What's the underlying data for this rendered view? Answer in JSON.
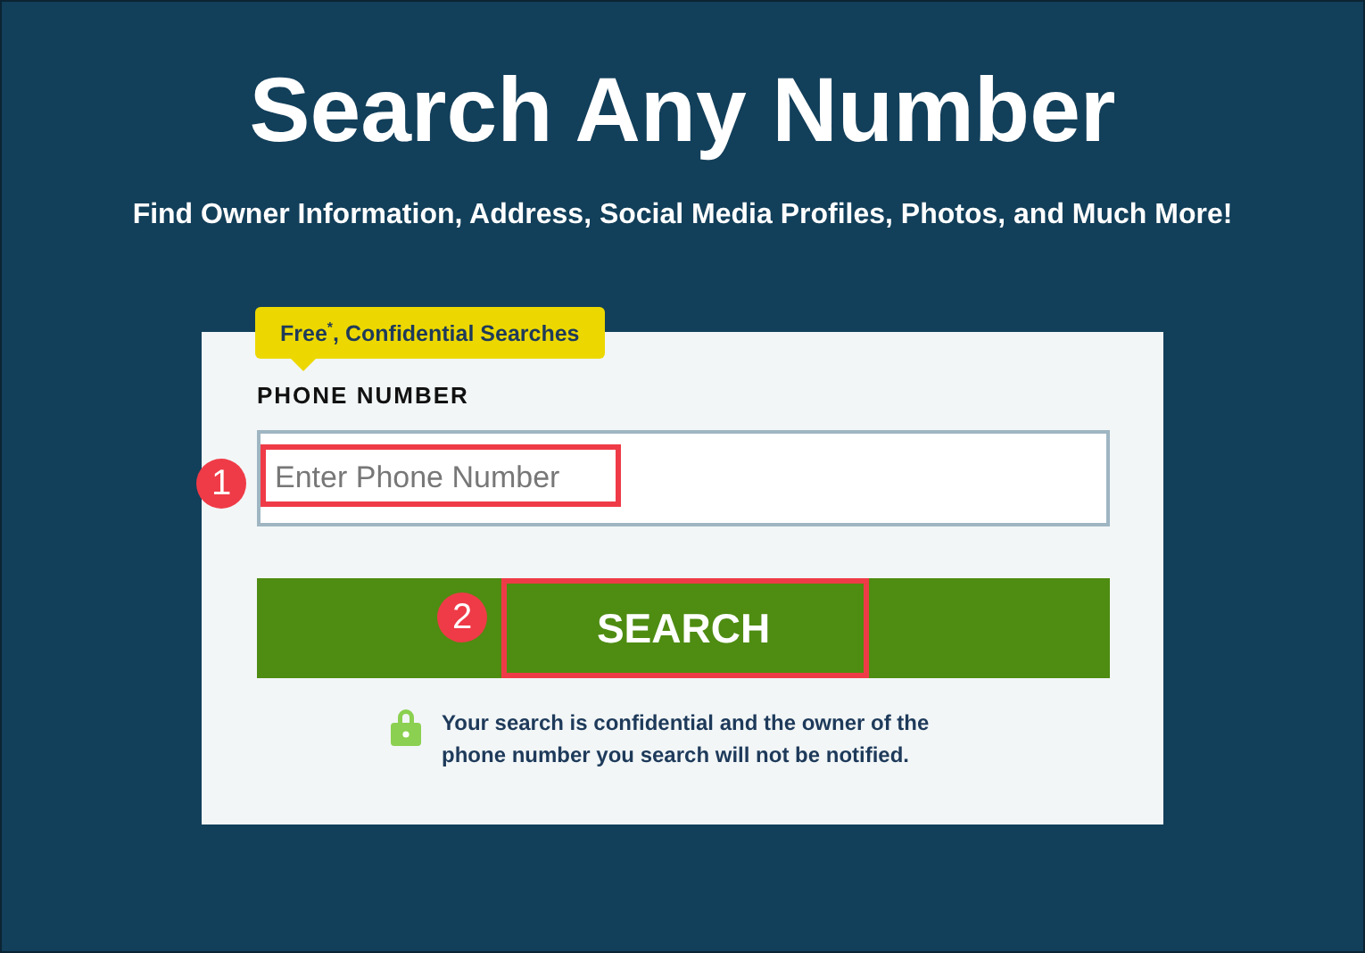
{
  "hero": {
    "title": "Search Any Number",
    "subtitle": "Find Owner Information, Address, Social Media Profiles, Photos, and Much More!"
  },
  "form": {
    "badge": "Free$^{*}$, Confidential Searches",
    "field_label": "PHONE NUMBER",
    "phone_field": {
      "placeholder": "Enter Phone Number"
    },
    "search_button": "SEARCH",
    "privacy_note": "Your search is confidential and the owner of the phone number you search will not be notified."
  },
  "annotations": [
    {
      "number": "1"
    },
    {
      "number": "2"
    }
  ]
}
